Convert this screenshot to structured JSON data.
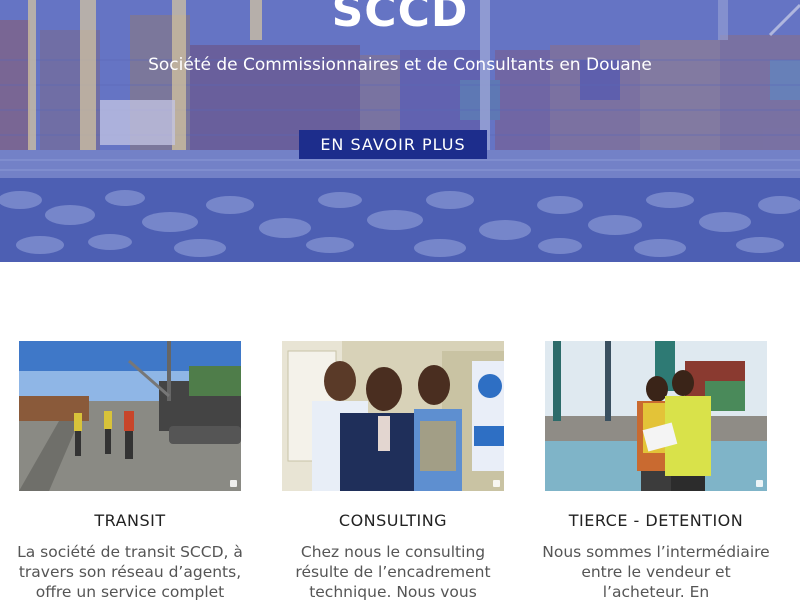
{
  "hero": {
    "title": "SCCD",
    "subtitle": "Société de Commissionnaires et de Consultants en Douane",
    "cta_label": "EN SAVOIR PLUS"
  },
  "services": [
    {
      "title": "TRANSIT",
      "text": "La société de transit SCCD, à travers son réseau d’agents, offre un service complet"
    },
    {
      "title": "CONSULTING",
      "text": "Chez nous le consulting résulte de l’encadrement technique. Nous vous"
    },
    {
      "title": "TIERCE - DETENTION",
      "text": "Nous sommes l’intermédiaire entre le vendeur et l’acheteur. En"
    }
  ]
}
